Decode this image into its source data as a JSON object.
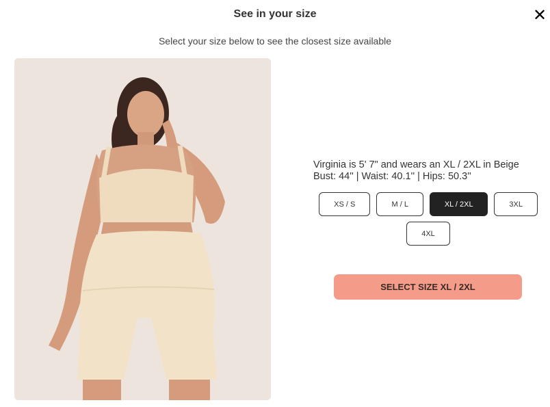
{
  "modal": {
    "title": "See in your size",
    "close_icon": "✕",
    "subtitle": "Select your size below to see the closest size available"
  },
  "model": {
    "image_alt": "model-photo",
    "description": "Virginia is 5' 7\" and wears an XL / 2XL in Beige",
    "measurements": "Bust: 44'' | Waist: 40.1'' | Hips: 50.3''"
  },
  "sizes": {
    "options": [
      "XS / S",
      "M / L",
      "XL / 2XL",
      "3XL",
      "4XL"
    ],
    "selected": "XL / 2XL"
  },
  "cta": {
    "label": "SELECT SIZE XL / 2XL"
  },
  "colors": {
    "cta_bg": "#f49c89",
    "selected_bg": "#222222",
    "photo_bg": "#ece4dd",
    "garment": "#f2e3c8"
  }
}
